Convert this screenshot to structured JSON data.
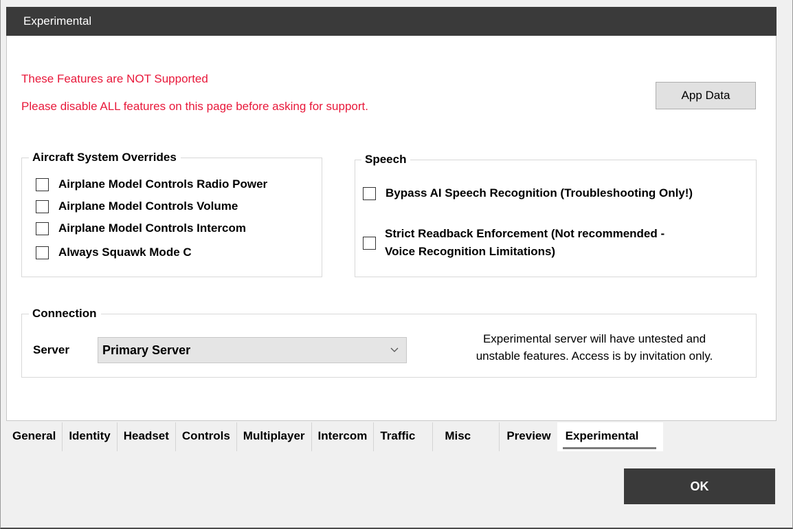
{
  "panel": {
    "title": "Experimental"
  },
  "warnings": {
    "line1": "These Features are NOT Supported",
    "line2": "Please disable ALL features on this page before asking for support."
  },
  "app_data_button": "App Data",
  "aircraft_overrides": {
    "title": "Aircraft System Overrides",
    "items": [
      {
        "label": "Airplane Model Controls Radio Power",
        "checked": false
      },
      {
        "label": "Airplane Model Controls Volume",
        "checked": false
      },
      {
        "label": "Airplane Model Controls Intercom",
        "checked": false
      },
      {
        "label": "Always Squawk Mode C",
        "checked": false
      }
    ]
  },
  "speech": {
    "title": "Speech",
    "items": [
      {
        "label": "Bypass AI Speech Recognition (Troubleshooting Only!)",
        "checked": false
      },
      {
        "label_line1": "Strict Readback Enforcement (Not recommended -",
        "label_line2": "Voice Recognition Limitations)",
        "checked": false
      }
    ]
  },
  "connection": {
    "title": "Connection",
    "server_label": "Server",
    "server_value": "Primary Server",
    "note_line1": "Experimental server will have untested and",
    "note_line2": "unstable features. Access is by invitation only."
  },
  "tabs": [
    {
      "label": "General",
      "active": false
    },
    {
      "label": "Identity",
      "active": false
    },
    {
      "label": "Headset",
      "active": false
    },
    {
      "label": "Controls",
      "active": false
    },
    {
      "label": "Multiplayer",
      "active": false
    },
    {
      "label": "Intercom",
      "active": false
    },
    {
      "label": "Traffic",
      "active": false
    },
    {
      "label": "Misc",
      "active": false
    },
    {
      "label": "Preview",
      "active": false
    },
    {
      "label": "Experimental",
      "active": true
    }
  ],
  "ok_button": "OK",
  "colors": {
    "header": "#3a3a3a",
    "warning": "#e8183a",
    "ok_button": "#3a3a3a"
  }
}
